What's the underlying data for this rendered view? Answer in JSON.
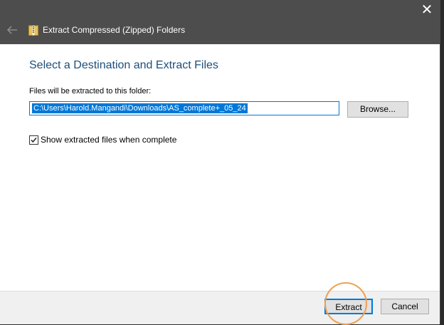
{
  "window": {
    "title": "Extract Compressed (Zipped) Folders",
    "close_glyph": "✕"
  },
  "content": {
    "heading": "Select a Destination and Extract Files",
    "destination_label": "Files will be extracted to this folder:",
    "destination_value": "C:\\Users\\Harold.Mangandi\\Downloads\\AS_complete+_05_24",
    "browse_label": "Browse...",
    "show_files_label": "Show extracted files when complete",
    "show_files_checked": true
  },
  "footer": {
    "extract_label": "Extract",
    "cancel_label": "Cancel"
  },
  "colors": {
    "titlebar": "#4d4d4d",
    "heading": "#1e4e79",
    "accent": "#0078d7",
    "annotation_ring": "#f0a050"
  },
  "icons": [
    "back-arrow-icon",
    "zip-folder-icon",
    "close-icon",
    "checkmark-icon"
  ]
}
